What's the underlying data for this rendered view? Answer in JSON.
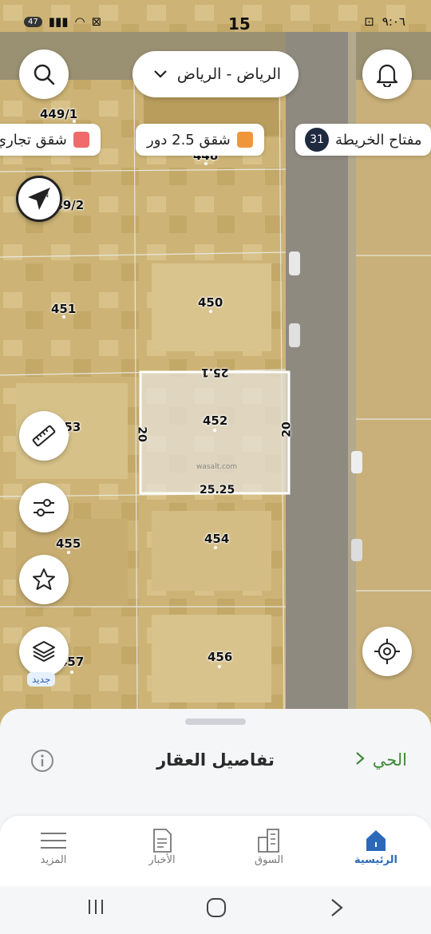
{
  "status": {
    "time": "٩:٠٦",
    "center_number": "15",
    "battery": "47"
  },
  "header": {
    "city_select": "الرياض - الرياض"
  },
  "legend": {
    "map_key_label": "مفتاح الخريطة",
    "map_key_count": "31",
    "item_1": "شقق 2.5 دور",
    "item_2": "شقق تجاري",
    "item_1_color": "#f0963a",
    "item_2_color": "#ef6b6b"
  },
  "parcels": {
    "p449": "449/1",
    "p448": "448",
    "p449b": "449/2",
    "p451": "451",
    "p450": "450",
    "p452": "452",
    "p453": "453",
    "p454": "454",
    "p455": "455",
    "p456": "456",
    "p457": "457"
  },
  "dimensions": {
    "top": "25.1",
    "bottom": "25.25",
    "left": "20",
    "right": "20"
  },
  "watermark": "wasalt.com",
  "map_badges": {
    "new_label": "جديد"
  },
  "sheet": {
    "title": "تفاصيل العقار",
    "district_link": "الحي"
  },
  "tabs": {
    "home": "الرئيسية",
    "market": "السوق",
    "news": "الأخبار",
    "more": "المزيد"
  },
  "colors": {
    "accent": "#2c6ab9",
    "district_green": "#3e8a3a"
  }
}
